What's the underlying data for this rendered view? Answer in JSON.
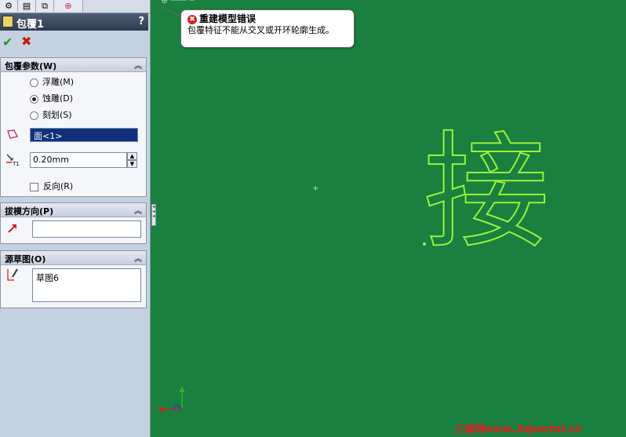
{
  "panel": {
    "tab_icons": [
      "feature-manager-icon",
      "property-manager-icon",
      "configuration-manager-icon",
      "display-manager-icon"
    ],
    "title": "包覆1",
    "help": "?",
    "ok_glyph": "✔",
    "cancel_glyph": "✖"
  },
  "wrap_params": {
    "title": "包覆参数(W)",
    "options": [
      "浮雕(M)",
      "蚀雕(D)",
      "刻划(S)"
    ],
    "selected_option": "蚀雕(D)",
    "face_value": "面<1>",
    "thickness_value": "0.20mm",
    "reverse_label": "反向(R)",
    "reverse_checked": false
  },
  "pull_direction": {
    "title": "拔模方向(P)",
    "value": ""
  },
  "source_sketch": {
    "title": "源草图(O)",
    "value": "草图6"
  },
  "error_tooltip": {
    "title": "重建模型错误",
    "message": "包覆特征不能从交叉或开环轮廓生成。"
  },
  "canvas": {
    "glyph": "接",
    "background_color": "#19803f",
    "outline_color": "#9bf23a"
  },
  "watermark": "三维网www.3dportal.cn"
}
